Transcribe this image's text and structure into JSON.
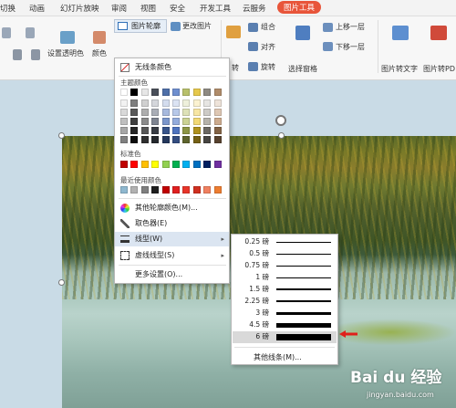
{
  "tabs": [
    {
      "label": "切换"
    },
    {
      "label": "动画"
    },
    {
      "label": "幻灯片放映"
    },
    {
      "label": "审阅"
    },
    {
      "label": "视图"
    },
    {
      "label": "安全"
    },
    {
      "label": "开发工具"
    },
    {
      "label": "云服务"
    },
    {
      "label": "图片工具"
    }
  ],
  "ribbon": {
    "outline_button": "图片轮廓",
    "change_picture": "更改图片",
    "set_transparent": "设置透明色",
    "color": "颜色",
    "rotate": "转",
    "group": "组合",
    "align": "对齐",
    "rotate2": "旋转",
    "selection_pane": "选择窗格",
    "bring_forward": "上移一层",
    "send_backward": "下移一层",
    "pic_to_text": "图片转文字",
    "pic_to_pdf": "图片转PD"
  },
  "menu": {
    "no_line": "无线条颜色",
    "theme_colors": "主题颜色",
    "standard_colors": "标准色",
    "recent_colors": "最近使用颜色",
    "more_colors": "其他轮廓颜色(M)...",
    "eyedropper": "取色器(E)",
    "line_weight": "线型(W)",
    "dash_type": "虚线线型(S)",
    "more_settings": "更多设置(O)..."
  },
  "theme_row": [
    "#ffffff",
    "#000000",
    "#e6e6e6",
    "#4a4f5a",
    "#4e6fa8",
    "#6f8fcf",
    "#b8c06b",
    "#e6c84c",
    "#8e8a82",
    "#b08c6a"
  ],
  "theme_shades": [
    [
      "#f2f2f2",
      "#7f7f7f",
      "#d0d0d0",
      "#d4d6db",
      "#d3dcee",
      "#dbe3f3",
      "#eef0db",
      "#fbf2d1",
      "#e6e5e2",
      "#eee3d9"
    ],
    [
      "#d9d9d9",
      "#595959",
      "#aeaeae",
      "#a9adb6",
      "#a7b9dd",
      "#b7c8e8",
      "#dde1b7",
      "#f7e6a4",
      "#cdcbc6",
      "#dec7b3"
    ],
    [
      "#bfbfbf",
      "#3f3f3f",
      "#8b8b8b",
      "#7e8491",
      "#7b96cb",
      "#94acdc",
      "#cbd293",
      "#f2d976",
      "#b5b2aa",
      "#cdab8e"
    ],
    [
      "#a6a6a6",
      "#262626",
      "#575757",
      "#383c44",
      "#37548a",
      "#4f74bf",
      "#8d9645",
      "#b0921f",
      "#6b6862",
      "#836346"
    ],
    [
      "#808080",
      "#0d0d0d",
      "#2f2f2f",
      "#25282d",
      "#25385c",
      "#344d80",
      "#5e642e",
      "#756115",
      "#474541",
      "#57422f"
    ]
  ],
  "standard_row": [
    "#c00000",
    "#ff0000",
    "#ffc000",
    "#ffff00",
    "#92d050",
    "#00b050",
    "#00b0f0",
    "#0070c0",
    "#002060",
    "#7030a0"
  ],
  "recent_row": [
    "#8fb8cf",
    "#b2b2b2",
    "#7f7f7f",
    "#1f1f1f",
    "#c00000",
    "#e02020",
    "#e8352a",
    "#d03020",
    "#f08060",
    "#ed7d31"
  ],
  "line_weights": [
    {
      "label": "0.25 磅",
      "weight": 0.25
    },
    {
      "label": "0.5 磅",
      "weight": 0.5
    },
    {
      "label": "0.75 磅",
      "weight": 0.75
    },
    {
      "label": "1 磅",
      "weight": 1
    },
    {
      "label": "1.5 磅",
      "weight": 1.5
    },
    {
      "label": "2.25 磅",
      "weight": 2.25
    },
    {
      "label": "3 磅",
      "weight": 3
    },
    {
      "label": "4.5 磅",
      "weight": 4.5
    },
    {
      "label": "6 磅",
      "weight": 6
    }
  ],
  "other_lines": "其他线条(M)...",
  "watermark": "Bai du 经验",
  "watermark_sub": "jingyan.baidu.com"
}
